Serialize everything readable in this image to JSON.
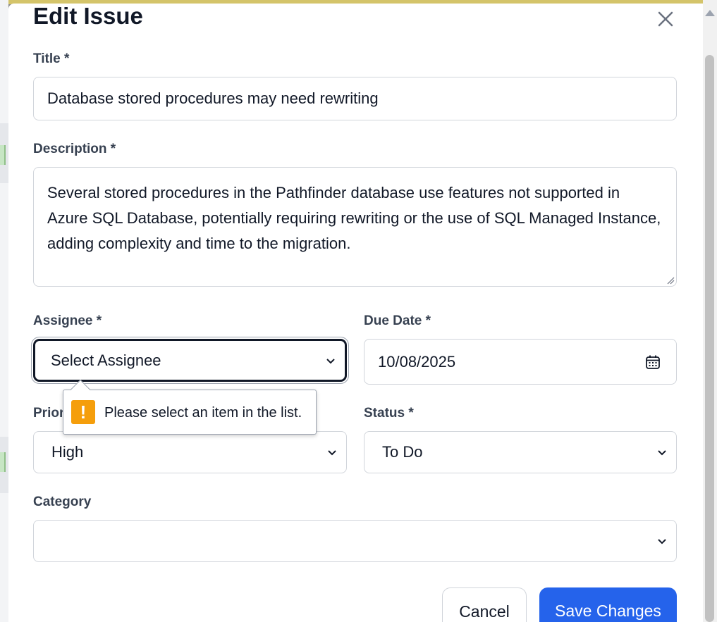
{
  "modal": {
    "title": "Edit Issue",
    "close_icon": "close-icon"
  },
  "fields": {
    "title": {
      "label": "Title *",
      "value": "Database stored procedures may need rewriting"
    },
    "description": {
      "label": "Description *",
      "value": "Several stored procedures in the Pathfinder database use features not supported in Azure SQL Database, potentially requiring rewriting or the use of SQL Managed Instance, adding complexity and time to the migration."
    },
    "assignee": {
      "label": "Assignee *",
      "value": "Select Assignee"
    },
    "due_date": {
      "label": "Due Date *",
      "value": "10/08/2025",
      "icon": "calendar-icon"
    },
    "priority": {
      "label": "Priority *",
      "value": "High"
    },
    "status": {
      "label": "Status *",
      "value": "To Do"
    },
    "category": {
      "label": "Category",
      "value": ""
    }
  },
  "validation_tooltip": {
    "icon": "warning-icon",
    "message": "Please select an item in the list."
  },
  "buttons": {
    "cancel": "Cancel",
    "save": "Save Changes"
  },
  "colors": {
    "primary": "#2563eb",
    "warning": "#f59e0b",
    "focus_border": "#111827"
  }
}
